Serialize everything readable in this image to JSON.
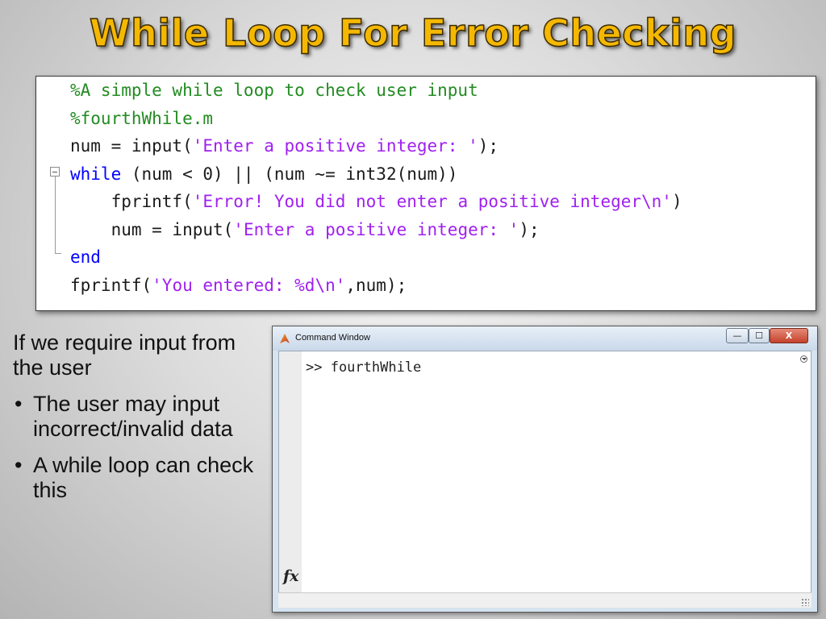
{
  "slide": {
    "title": "While Loop For Error Checking"
  },
  "code": {
    "lines": [
      [
        {
          "t": "%A simple while loop to check user input",
          "c": "comment"
        }
      ],
      [
        {
          "t": "%fourthWhile.m",
          "c": "comment"
        }
      ],
      [
        {
          "t": "num = input(",
          "c": "plain"
        },
        {
          "t": "'Enter a positive integer: '",
          "c": "string"
        },
        {
          "t": ");",
          "c": "plain"
        }
      ],
      [
        {
          "t": "while",
          "c": "keyword"
        },
        {
          "t": " (num < 0) || (num ~= int32(num))",
          "c": "plain"
        }
      ],
      [
        {
          "t": "    fprintf(",
          "c": "plain"
        },
        {
          "t": "'Error! You did not enter a positive integer\\n'",
          "c": "string"
        },
        {
          "t": ")",
          "c": "plain"
        }
      ],
      [
        {
          "t": "    num = input(",
          "c": "plain"
        },
        {
          "t": "'Enter a positive integer: '",
          "c": "string"
        },
        {
          "t": ");",
          "c": "plain"
        }
      ],
      [
        {
          "t": "end",
          "c": "keyword"
        }
      ],
      [
        {
          "t": "fprintf(",
          "c": "plain"
        },
        {
          "t": "'You entered: %d\\n'",
          "c": "string"
        },
        {
          "t": ",num);",
          "c": "plain"
        }
      ]
    ],
    "colors": {
      "comment": "#228b22",
      "keyword": "#0000ff",
      "string": "#a020f0",
      "plain": "#1a1a1a"
    }
  },
  "bullets": {
    "lead": "If we require input from the user",
    "items": [
      "The user may input incorrect/invalid data",
      "A while loop can check this"
    ]
  },
  "command_window": {
    "title": "Command Window",
    "prompt_line": ">> fourthWhile",
    "fx_label": "fx",
    "buttons": {
      "minimize": "—",
      "maximize": "☐",
      "close": "X"
    }
  }
}
